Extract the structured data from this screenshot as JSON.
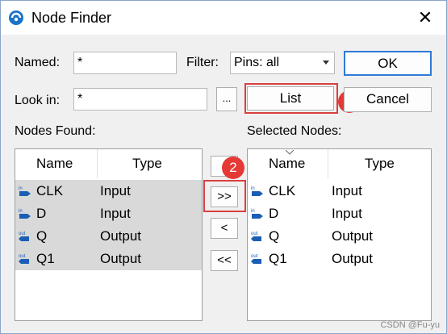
{
  "window": {
    "title": "Node Finder",
    "close": "✕"
  },
  "form": {
    "named_label": "Named:",
    "named_value": "*",
    "filter_label": "Filter:",
    "filter_value": "Pins: all",
    "lookin_label": "Look in:",
    "lookin_value": "*",
    "browse": "...",
    "list": "List",
    "ok": "OK",
    "cancel": "Cancel"
  },
  "found": {
    "title": "Nodes Found:",
    "col_name": "Name",
    "col_type": "Type",
    "rows": [
      {
        "icon": "in",
        "name": "CLK",
        "type": "Input"
      },
      {
        "icon": "in",
        "name": "D",
        "type": "Input"
      },
      {
        "icon": "out",
        "name": "Q",
        "type": "Output"
      },
      {
        "icon": "out",
        "name": "Q1",
        "type": "Output"
      }
    ]
  },
  "selected": {
    "title": "Selected Nodes:",
    "col_name": "Name",
    "col_type": "Type",
    "rows": [
      {
        "icon": "in",
        "name": "CLK",
        "type": "Input"
      },
      {
        "icon": "in",
        "name": "D",
        "type": "Input"
      },
      {
        "icon": "out",
        "name": "Q",
        "type": "Output"
      },
      {
        "icon": "out",
        "name": "Q1",
        "type": "Output"
      }
    ]
  },
  "transfer": {
    "add_all": ">>",
    "add": "<",
    "remove_all": "<<"
  },
  "annotations": {
    "one": "1",
    "two": "2"
  },
  "watermark": "CSDN @Fu-yu",
  "colors": {
    "accent": "#2f7ad6",
    "highlight": "#d94040",
    "badge": "#e53935",
    "selection": "#d9d9d9"
  }
}
